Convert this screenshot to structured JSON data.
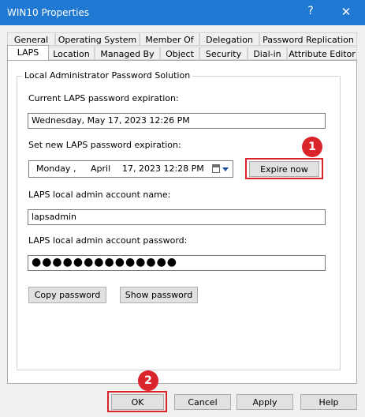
{
  "window": {
    "title": "WIN10 Properties",
    "help_glyph": "?",
    "close_glyph": "✕"
  },
  "tabs_row1": [
    "General",
    "Operating System",
    "Member Of",
    "Delegation",
    "Password Replication"
  ],
  "tabs_row2": [
    "LAPS",
    "Location",
    "Managed By",
    "Object",
    "Security",
    "Dial-in",
    "Attribute Editor"
  ],
  "active_tab": "LAPS",
  "laps": {
    "group_title": "Local Administrator Password Solution",
    "current_expiration_label": "Current LAPS password expiration:",
    "current_expiration_value": "Wednesday, May 17, 2023 12:26 PM",
    "new_expiration_label": "Set new LAPS password expiration:",
    "new_expiration": {
      "weekday": "Monday",
      "sep": ",",
      "month": "April",
      "rest": "17, 2023 12:28 PM"
    },
    "expire_now_label": "Expire now",
    "account_name_label": "LAPS local admin account name:",
    "account_name_value": "lapsadmin",
    "account_password_label": "LAPS local admin account password:",
    "account_password_value": "●●●●●●●●●●●●●●",
    "copy_password_label": "Copy password",
    "show_password_label": "Show password"
  },
  "footer": {
    "ok_label": "OK",
    "cancel_label": "Cancel",
    "apply_label": "Apply",
    "help_label": "Help"
  },
  "annotations": {
    "badge1": "1",
    "badge2": "2"
  },
  "colors": {
    "titlebar": "#1f78d1",
    "highlight": "#d9242b",
    "background": "#f0f0f0"
  }
}
